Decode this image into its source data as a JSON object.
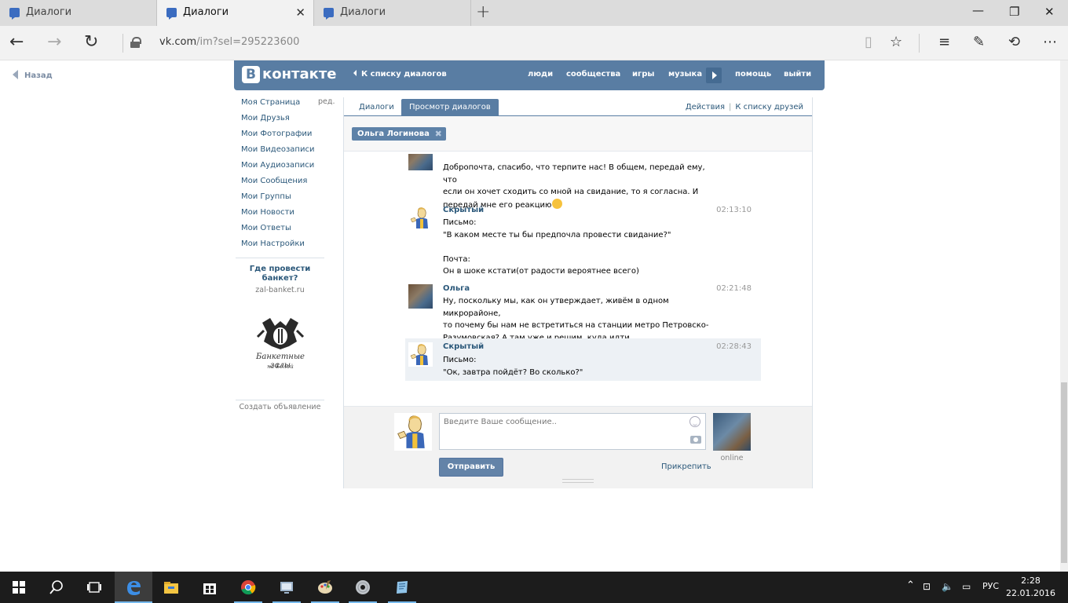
{
  "browser": {
    "tabs": [
      {
        "label": "Диалоги"
      },
      {
        "label": "Диалоги"
      },
      {
        "label": "Диалоги"
      }
    ],
    "url_host": "vk.com",
    "url_path": "/im?sel=295223600"
  },
  "page": {
    "back_link": "Назад"
  },
  "vk": {
    "logo_letter": "В",
    "logo_text": "контакте",
    "back_to_list": "К списку диалогов",
    "menu": [
      "люди",
      "сообщества",
      "игры",
      "музыка",
      "помощь",
      "выйти"
    ]
  },
  "sidebar": {
    "items": [
      "Моя Страница",
      "Мои Друзья",
      "Мои Фотографии",
      "Мои Видеозаписи",
      "Мои Аудиозаписи",
      "Мои Сообщения",
      "Мои Группы",
      "Мои Новости",
      "Мои Ответы",
      "Мои Настройки"
    ],
    "edit_label": "ред.",
    "ad_title": "Где провести банкет?",
    "ad_domain": "zal-banket.ru",
    "ad_logo_text_1": "Банкетные залы",
    "ad_logo_text_2": "на Белой",
    "create_ad": "Создать объявление"
  },
  "dialog": {
    "tabs": [
      "Диалоги",
      "Просмотр диалогов"
    ],
    "actions": [
      "Действия",
      "К списку друзей"
    ],
    "chip": "Ольга Логинова",
    "messages": [
      {
        "name": "",
        "time": "",
        "body": "Добропочта, спасибо, что терпите нас! В общем, передай ему, что\nесли он хочет сходить со мной на свидание, то я согласна. И\nпередай мне его реакцию"
      },
      {
        "name": "Скрытый",
        "time": "02:13:10",
        "body": "Письмо:\n\"В каком месте ты бы предпочла провести свидание?\"\n\nПочта:\nОн в шоке кстати(от радости вероятнее всего)"
      },
      {
        "name": "Ольга",
        "time": "02:21:48",
        "body": "Ну, поскольку мы, как он утверждает, живём в одном микрорайоне,\nто почему бы нам не встретиться на станции метро Петровско-\nРазумовская? А там уже и решим, куда идти."
      },
      {
        "name": "Скрытый",
        "time": "02:28:43",
        "body": "Письмо:\n\"Ок, завтра пойдёт? Во сколько?\""
      }
    ],
    "composer": {
      "placeholder": "Введите Ваше сообщение..",
      "send": "Отправить",
      "attach": "Прикрепить",
      "online": "online"
    }
  },
  "taskbar": {
    "lang": "РУС",
    "time": "2:28",
    "date": "22.01.2016"
  }
}
